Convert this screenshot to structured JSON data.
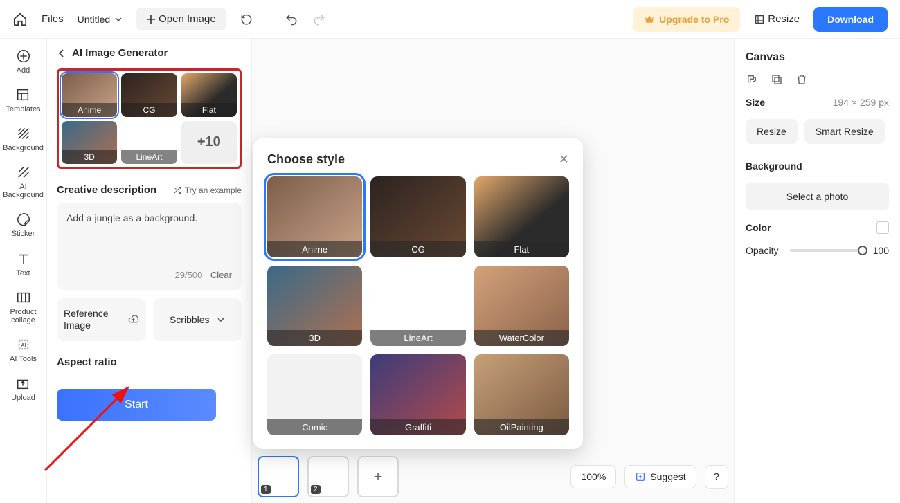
{
  "topbar": {
    "files": "Files",
    "untitled": "Untitled",
    "open_image": "Open Image",
    "upgrade": "Upgrade to Pro",
    "resize": "Resize",
    "download": "Download"
  },
  "rail": {
    "add": "Add",
    "templates": "Templates",
    "background": "Background",
    "ai_bg": "AI Background",
    "sticker": "Sticker",
    "text": "Text",
    "collage": "Product collage",
    "ai_tools": "AI Tools",
    "upload": "Upload"
  },
  "panel": {
    "title": "AI Image Generator",
    "styles": [
      "Anime",
      "CG",
      "Flat",
      "3D",
      "LineArt"
    ],
    "more": "+10",
    "creative": "Creative description",
    "try_example": "Try an example",
    "desc_value": "Add a jungle as a background.",
    "counter": "29/500",
    "clear": "Clear",
    "ref_image": "Reference Image",
    "scribbles": "Scribbles",
    "aspect_ratio": "Aspect ratio",
    "start": "Start"
  },
  "modal": {
    "title": "Choose style",
    "styles": [
      "Anime",
      "CG",
      "Flat",
      "3D",
      "LineArt",
      "WaterColor",
      "Comic",
      "Graffiti",
      "OilPainting"
    ]
  },
  "center": {
    "zoom": "100%",
    "suggest": "Suggest",
    "help": "?"
  },
  "right": {
    "canvas": "Canvas",
    "size_label": "Size",
    "size_value": "194 × 259 px",
    "resize": "Resize",
    "smart": "Smart Resize",
    "bg": "Background",
    "select_photo": "Select a photo",
    "color": "Color",
    "opacity": "Opacity",
    "opacity_value": "100"
  }
}
